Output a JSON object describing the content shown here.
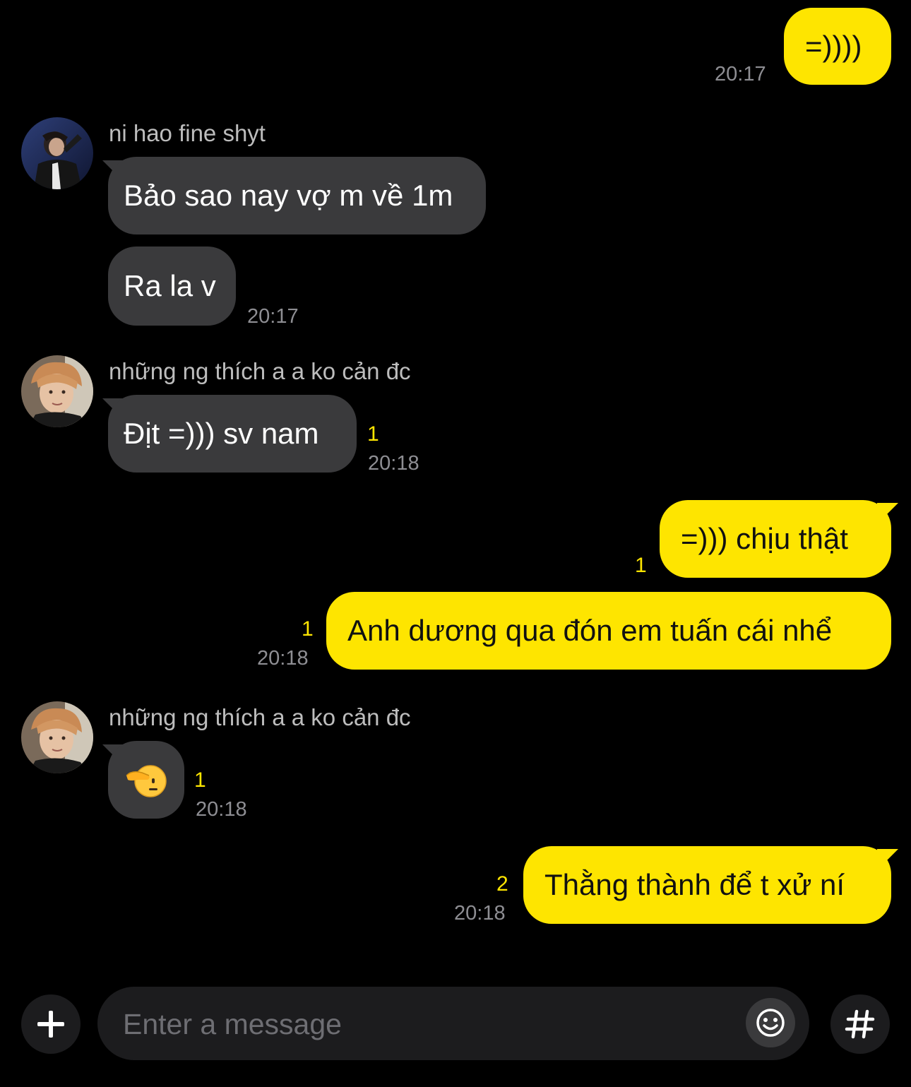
{
  "messages": [
    {
      "id": "m1",
      "direction": "out",
      "text": "=))))",
      "time": "20:17"
    },
    {
      "id": "m2",
      "direction": "in",
      "sender": "ni hao fine shyt",
      "text": "Bảo sao nay vợ m về 1m"
    },
    {
      "id": "m3",
      "direction": "in",
      "text": "Ra la v",
      "time": "20:17"
    },
    {
      "id": "m4",
      "direction": "in",
      "sender": "những ng thích a a ko cản đc",
      "text": "Địt =))) sv nam",
      "unread": "1",
      "time": "20:18"
    },
    {
      "id": "m5",
      "direction": "out",
      "text": "=))) chịu thật",
      "unread": "1"
    },
    {
      "id": "m6",
      "direction": "out",
      "text": "Anh dương qua đón em tuấn cái nhể",
      "unread": "1",
      "time": "20:18"
    },
    {
      "id": "m7",
      "direction": "in",
      "sender": "những ng thích a a ko cản đc",
      "sticker": "saluting-face-emoji",
      "unread": "1",
      "time": "20:18"
    },
    {
      "id": "m8",
      "direction": "out",
      "text": "Thằng thành để t xử ní",
      "unread": "2",
      "time": "20:18"
    }
  ],
  "composer": {
    "placeholder": "Enter a message",
    "add_icon": "plus-icon",
    "emoji_icon": "smiley-icon",
    "hashtag_icon": "hash-icon"
  },
  "colors": {
    "background": "#000000",
    "outgoing_bubble": "#FEE500",
    "incoming_bubble": "#3A3A3C",
    "unread_count": "#FEE500",
    "timestamp": "#8E8E93"
  }
}
